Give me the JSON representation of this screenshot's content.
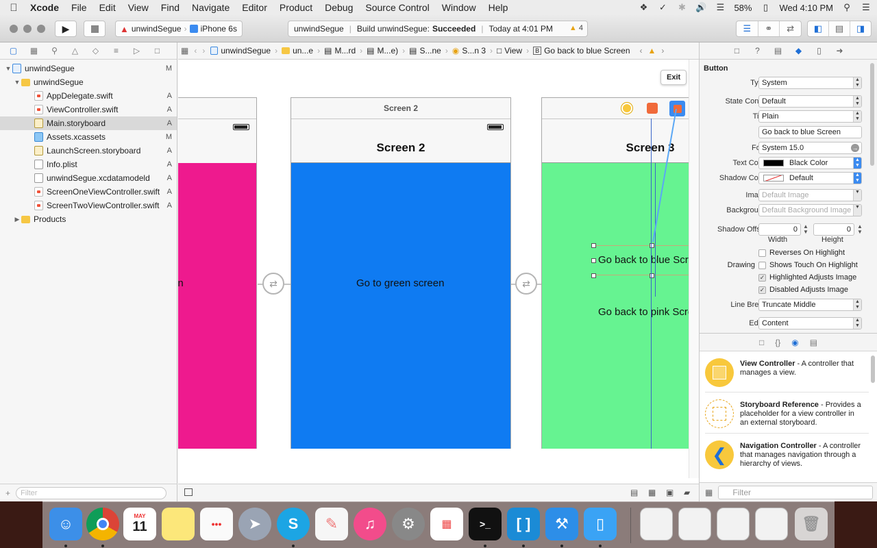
{
  "menubar": {
    "app": "Xcode",
    "items": [
      "File",
      "Edit",
      "View",
      "Find",
      "Navigate",
      "Editor",
      "Product",
      "Debug",
      "Source Control",
      "Window",
      "Help"
    ],
    "battery": "58%",
    "clock": "Wed 4:10 PM"
  },
  "toolbar": {
    "scheme": "unwindSegue",
    "device": "iPhone 6s",
    "activity": {
      "project": "unwindSegue",
      "build_prefix": "Build unwindSegue:",
      "build_status": "Succeeded",
      "time": "Today at 4:01 PM",
      "warnings": "4"
    }
  },
  "navigator": {
    "items": [
      {
        "label": "unwindSegue",
        "badge": "M",
        "icon": "project-icon"
      },
      {
        "label": "unwindSegue",
        "badge": "",
        "icon": "folder-icon"
      },
      {
        "label": "AppDelegate.swift",
        "badge": "A",
        "icon": "swift-file-icon"
      },
      {
        "label": "ViewController.swift",
        "badge": "A",
        "icon": "swift-file-icon"
      },
      {
        "label": "Main.storyboard",
        "badge": "A",
        "icon": "storyboard-file-icon"
      },
      {
        "label": "Assets.xcassets",
        "badge": "M",
        "icon": "asset-catalog-icon"
      },
      {
        "label": "LaunchScreen.storyboard",
        "badge": "A",
        "icon": "storyboard-file-icon"
      },
      {
        "label": "Info.plist",
        "badge": "A",
        "icon": "plist-file-icon"
      },
      {
        "label": "unwindSegue.xcdatamodeld",
        "badge": "A",
        "icon": "data-model-icon"
      },
      {
        "label": "ScreenOneViewController.swift",
        "badge": "A",
        "icon": "swift-file-icon"
      },
      {
        "label": "ScreenTwoViewController.swift",
        "badge": "A",
        "icon": "swift-file-icon"
      },
      {
        "label": "Products",
        "badge": "",
        "icon": "folder-icon"
      }
    ],
    "filter_placeholder": "Filter"
  },
  "jumpbar": {
    "crumbs": [
      "unwindSegue",
      "un...e",
      "M...rd",
      "M...e)",
      "S...ne",
      "S...n 3",
      "View",
      "Go back to blue Screen"
    ]
  },
  "canvas": {
    "scene1": {
      "button": "en"
    },
    "scene2": {
      "title": "Screen 2",
      "navbar_title": "Screen 2",
      "button": "Go to green screen"
    },
    "scene3": {
      "navbar_title": "Screen 3",
      "button1": "Go back to blue Screen",
      "button2": "Go back to pink Screen"
    },
    "exit_tooltip": "Exit"
  },
  "inspector": {
    "section": "Button",
    "type": {
      "label": "Type",
      "value": "System"
    },
    "state_config": {
      "label": "State Config",
      "value": "Default"
    },
    "title": {
      "label": "Title",
      "value": "Plain",
      "text": "Go back to blue Screen"
    },
    "font": {
      "label": "Font",
      "value": "System 15.0"
    },
    "text_color": {
      "label": "Text Color",
      "value": "Black Color"
    },
    "shadow_color": {
      "label": "Shadow Color",
      "value": "Default"
    },
    "image": {
      "label": "Image",
      "placeholder": "Default Image"
    },
    "background": {
      "label": "Background",
      "placeholder": "Default Background Image"
    },
    "shadow_offset": {
      "label": "Shadow Offset",
      "width": "0",
      "height": "0",
      "width_label": "Width",
      "height_label": "Height"
    },
    "drawing_label": "Drawing",
    "checks": [
      {
        "label": "Reverses On Highlight",
        "checked": false
      },
      {
        "label": "Shows Touch On Highlight",
        "checked": false
      },
      {
        "label": "Highlighted Adjusts Image",
        "checked": true
      },
      {
        "label": "Disabled Adjusts Image",
        "checked": true
      }
    ],
    "line_break": {
      "label": "Line Break",
      "value": "Truncate Middle"
    },
    "edge": {
      "label": "Edge",
      "value": "Content"
    }
  },
  "library": {
    "items": [
      {
        "title": "View Controller",
        "desc": " - A controller that manages a view."
      },
      {
        "title": "Storyboard Reference",
        "desc": " - Provides a placeholder for a view controller in an external storyboard."
      },
      {
        "title": "Navigation Controller",
        "desc": " - A controller that manages navigation through a hierarchy of views."
      }
    ],
    "filter_placeholder": "Filter"
  },
  "dock": {
    "calendar_month": "MAY",
    "calendar_day": "11"
  },
  "colors": {
    "pink": "#ee1a8e",
    "blue": "#0f7bf2",
    "green": "#66f391",
    "accent": "#1f6fd6"
  }
}
